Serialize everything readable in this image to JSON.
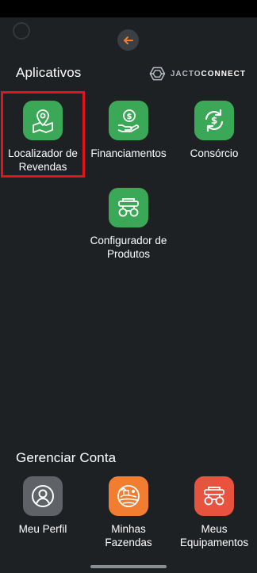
{
  "header": {
    "back_icon": "arrow-left-icon",
    "accent": "#f07d30"
  },
  "apps_section": {
    "title": "Aplicativos",
    "brand": {
      "light": "JACTO",
      "bold": "CONNECT"
    },
    "items": [
      {
        "label": "Localizador de\nRevendas",
        "icon": "map-pin-icon",
        "color": "#3aa856",
        "highlighted": true
      },
      {
        "label": "Financiamentos",
        "icon": "money-hand-icon",
        "color": "#3aa856"
      },
      {
        "label": "Consórcio",
        "icon": "dollar-cycle-icon",
        "color": "#3aa856"
      },
      {
        "label": "Configurador de\nProdutos",
        "icon": "machine-icon",
        "color": "#3aa856"
      }
    ]
  },
  "account_section": {
    "title": "Gerenciar Conta",
    "items": [
      {
        "label": "Meu Perfil",
        "icon": "user-icon",
        "color": "#5f6368"
      },
      {
        "label": "Minhas\nFazendas",
        "icon": "farm-icon",
        "color": "#f07d30"
      },
      {
        "label": "Meus\nEquipamentos",
        "icon": "equipment-icon",
        "color": "#e7533f"
      }
    ]
  }
}
